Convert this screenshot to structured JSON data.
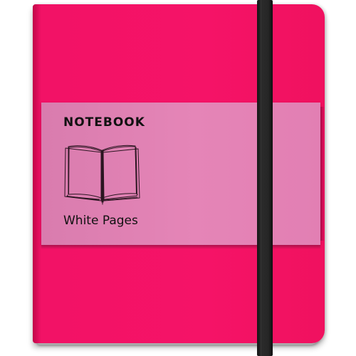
{
  "notebook": {
    "label": {
      "title": "NOTEBOOK",
      "subtitle": "White Pages",
      "illustration_icon": "open-book-sketch-icon"
    },
    "colors": {
      "cover": "#f51367",
      "label_band": "#e585b7",
      "elastic_strap": "#262626",
      "page_edges": "#f3f3f3"
    }
  }
}
